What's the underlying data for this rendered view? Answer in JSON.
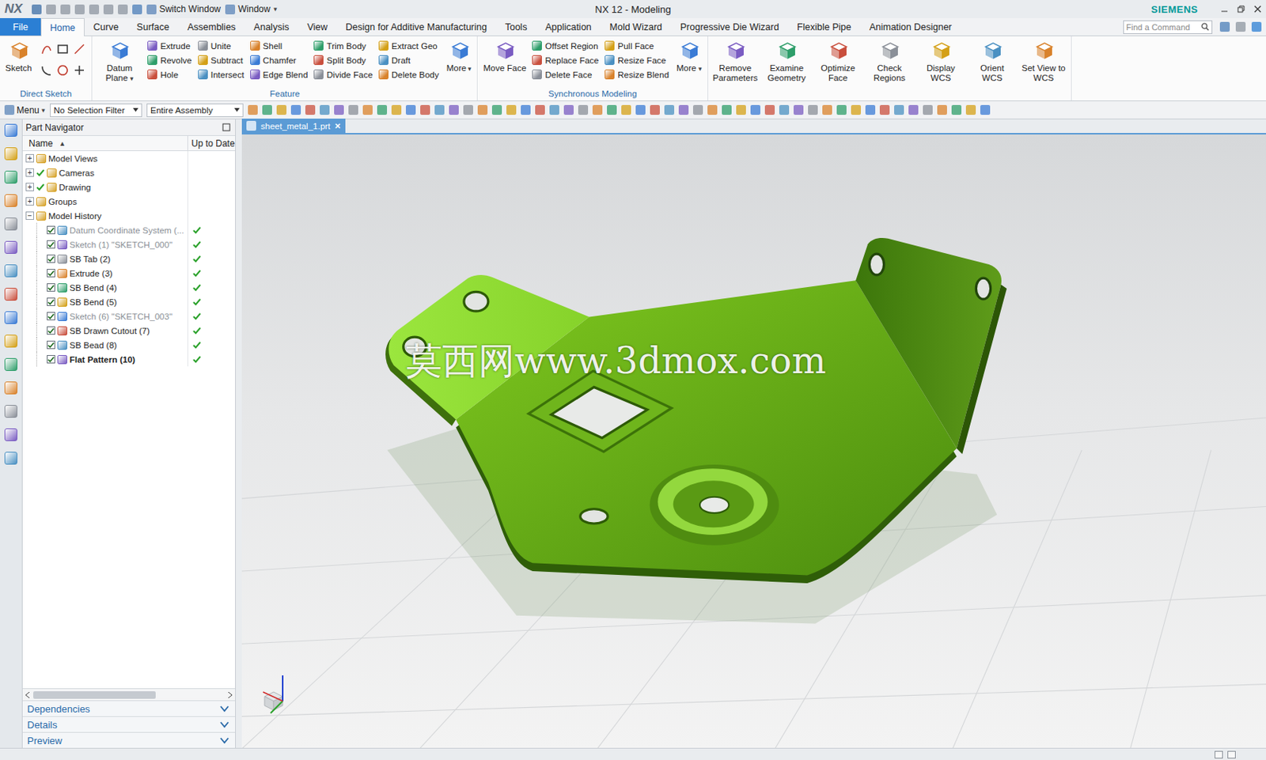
{
  "title_bar": {
    "logo": "NX",
    "title": "NX 12 - Modeling",
    "brand": "SIEMENS",
    "commands": [
      {
        "label": "Switch Window",
        "dropdown": ""
      },
      {
        "label": "Window",
        "dropdown": "▾"
      }
    ]
  },
  "menu_tabs": [
    {
      "label": "File",
      "selected": false,
      "kind": "file"
    },
    {
      "label": "Home",
      "selected": true,
      "kind": "tab"
    },
    {
      "label": "Curve",
      "selected": false,
      "kind": "tab"
    },
    {
      "label": "Surface",
      "selected": false,
      "kind": "tab"
    },
    {
      "label": "Assemblies",
      "selected": false,
      "kind": "tab"
    },
    {
      "label": "Analysis",
      "selected": false,
      "kind": "tab"
    },
    {
      "label": "View",
      "selected": false,
      "kind": "tab"
    },
    {
      "label": "Design for Additive Manufacturing",
      "selected": false,
      "kind": "tab"
    },
    {
      "label": "Tools",
      "selected": false,
      "kind": "tab"
    },
    {
      "label": "Application",
      "selected": false,
      "kind": "tab"
    },
    {
      "label": "Mold Wizard",
      "selected": false,
      "kind": "tab"
    },
    {
      "label": "Progressive Die Wizard",
      "selected": false,
      "kind": "tab"
    },
    {
      "label": "Flexible Pipe",
      "selected": false,
      "kind": "tab"
    },
    {
      "label": "Animation Designer",
      "selected": false,
      "kind": "tab"
    }
  ],
  "search": {
    "placeholder": "Find a Command"
  },
  "ribbon": {
    "groups": [
      {
        "label": "Direct Sketch",
        "items": [
          {
            "kind": "large",
            "label": "Sketch",
            "dropdown": false
          },
          {
            "kind": "sketch_tools"
          }
        ]
      },
      {
        "label": "Feature",
        "items": [
          {
            "kind": "large",
            "label": "Datum Plane",
            "dropdown": true
          },
          {
            "kind": "column",
            "items": [
              "Extrude",
              "Revolve",
              "Hole"
            ]
          },
          {
            "kind": "column",
            "items": [
              "Unite",
              "Subtract",
              "Intersect"
            ]
          },
          {
            "kind": "column",
            "items": [
              "Shell",
              "Chamfer",
              "Edge Blend"
            ]
          },
          {
            "kind": "column",
            "items": [
              "Trim Body",
              "Split Body",
              "Divide Face"
            ]
          },
          {
            "kind": "column",
            "items": [
              "Extract Geo",
              "Draft",
              "Delete Body"
            ]
          },
          {
            "kind": "large",
            "label": "More",
            "dropdown": true
          }
        ]
      },
      {
        "label": "Synchronous Modeling",
        "items": [
          {
            "kind": "large",
            "label": "Move Face",
            "dropdown": false
          },
          {
            "kind": "column",
            "items": [
              "Offset Region",
              "Replace Face",
              "Delete Face"
            ]
          },
          {
            "kind": "column",
            "items": [
              "Pull Face",
              "Resize Face",
              "Resize Blend"
            ]
          },
          {
            "kind": "large",
            "label": "More",
            "dropdown": true
          }
        ]
      },
      {
        "label": "",
        "items": [
          {
            "kind": "large",
            "label": "Remove Parameters",
            "dropdown": false
          },
          {
            "kind": "large",
            "label": "Examine Geometry",
            "dropdown": false
          },
          {
            "kind": "large",
            "label": "Optimize Face",
            "dropdown": false
          },
          {
            "kind": "large",
            "label": "Check Regions",
            "dropdown": false
          },
          {
            "kind": "large",
            "label": "Display WCS",
            "dropdown": false
          },
          {
            "kind": "large",
            "label": "Orient WCS",
            "dropdown": false
          },
          {
            "kind": "large",
            "label": "Set View to WCS",
            "dropdown": false
          }
        ]
      }
    ]
  },
  "selection_bar": {
    "menu": "Menu",
    "menu_arrow": "▾",
    "dropdowns": [
      "No Selection Filter",
      "Entire Assembly"
    ]
  },
  "part_navigator": {
    "title": "Part Navigator",
    "columns": [
      {
        "label": "Name",
        "sort": "▲"
      },
      {
        "label": "Up to Date",
        "sort": ""
      }
    ],
    "rows": [
      {
        "label": "Model Views",
        "depth": 0,
        "expander": "+",
        "visible_check": false,
        "checkbox": false,
        "checked": false,
        "greyed": false,
        "bold": false,
        "up_to_date": false
      },
      {
        "label": "Cameras",
        "depth": 0,
        "expander": "+",
        "visible_check": true,
        "checkbox": false,
        "checked": false,
        "greyed": false,
        "bold": false,
        "up_to_date": false
      },
      {
        "label": "Drawing",
        "depth": 0,
        "expander": "+",
        "visible_check": true,
        "checkbox": false,
        "checked": false,
        "greyed": false,
        "bold": false,
        "up_to_date": false
      },
      {
        "label": "Groups",
        "depth": 0,
        "expander": "+",
        "visible_check": false,
        "checkbox": false,
        "checked": false,
        "greyed": false,
        "bold": false,
        "up_to_date": false
      },
      {
        "label": "Model History",
        "depth": 0,
        "expander": "−",
        "visible_check": false,
        "checkbox": false,
        "checked": false,
        "greyed": false,
        "bold": false,
        "up_to_date": false
      },
      {
        "label": "Datum Coordinate System (...",
        "depth": 1,
        "expander": "",
        "visible_check": false,
        "checkbox": true,
        "checked": true,
        "greyed": true,
        "bold": false,
        "up_to_date": true
      },
      {
        "label": "Sketch (1) \"SKETCH_000\"",
        "depth": 1,
        "expander": "",
        "visible_check": false,
        "checkbox": true,
        "checked": true,
        "greyed": true,
        "bold": false,
        "up_to_date": true
      },
      {
        "label": "SB Tab (2)",
        "depth": 1,
        "expander": "",
        "visible_check": false,
        "checkbox": true,
        "checked": true,
        "greyed": false,
        "bold": false,
        "up_to_date": true
      },
      {
        "label": "Extrude (3)",
        "depth": 1,
        "expander": "",
        "visible_check": false,
        "checkbox": true,
        "checked": true,
        "greyed": false,
        "bold": false,
        "up_to_date": true
      },
      {
        "label": "SB Bend (4)",
        "depth": 1,
        "expander": "",
        "visible_check": false,
        "checkbox": true,
        "checked": true,
        "greyed": false,
        "bold": false,
        "up_to_date": true
      },
      {
        "label": "SB Bend (5)",
        "depth": 1,
        "expander": "",
        "visible_check": false,
        "checkbox": true,
        "checked": true,
        "greyed": false,
        "bold": false,
        "up_to_date": true
      },
      {
        "label": "Sketch (6) \"SKETCH_003\"",
        "depth": 1,
        "expander": "",
        "visible_check": false,
        "checkbox": true,
        "checked": true,
        "greyed": true,
        "bold": false,
        "up_to_date": true
      },
      {
        "label": "SB Drawn Cutout (7)",
        "depth": 1,
        "expander": "",
        "visible_check": false,
        "checkbox": true,
        "checked": true,
        "greyed": false,
        "bold": false,
        "up_to_date": true
      },
      {
        "label": "SB Bead (8)",
        "depth": 1,
        "expander": "",
        "visible_check": false,
        "checkbox": true,
        "checked": true,
        "greyed": false,
        "bold": false,
        "up_to_date": true
      },
      {
        "label": "Flat Pattern (10)",
        "depth": 1,
        "expander": "",
        "visible_check": false,
        "checkbox": true,
        "checked": true,
        "greyed": false,
        "bold": true,
        "up_to_date": true
      }
    ],
    "panels": [
      "Dependencies",
      "Details",
      "Preview"
    ]
  },
  "graphics": {
    "tab": {
      "label": "sheet_metal_1.prt",
      "close": "×",
      "selected": true
    },
    "watermark": "莫西网www.3dmox.com"
  }
}
